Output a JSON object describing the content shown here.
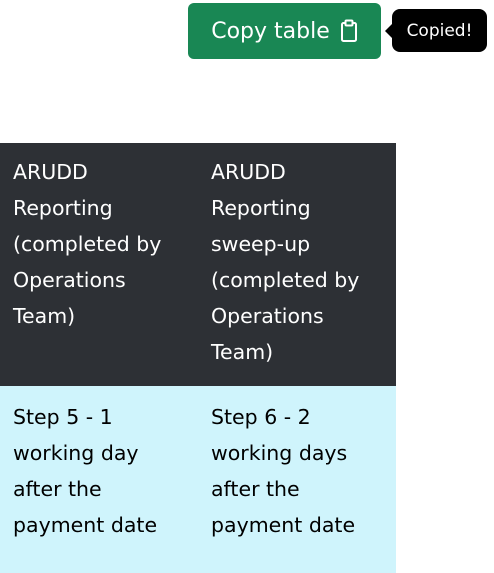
{
  "copy_button": {
    "label": "Copy table",
    "icon": "clipboard-icon"
  },
  "tooltip": {
    "text": "Copied!"
  },
  "table": {
    "headers": [
      "ARUDD Reporting (completed by Operations Team)",
      "ARUDD Reporting sweep-up (completed by Operations Team)"
    ],
    "rows": [
      [
        "Step 5 - 1 working day after the payment date",
        "Step 6 - 2 working days after the payment date"
      ]
    ]
  }
}
